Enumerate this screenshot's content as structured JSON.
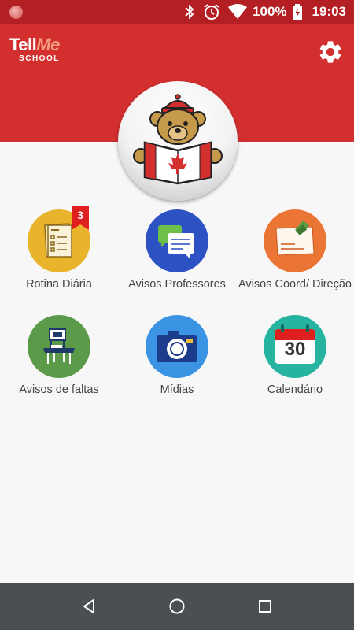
{
  "status_bar": {
    "battery": "100%",
    "time": "19:03",
    "icons": [
      "app-notification-icon",
      "bluetooth-icon",
      "alarm-icon",
      "wifi-icon",
      "battery-charging-icon"
    ]
  },
  "app_bar": {
    "logo_main_a": "Tell",
    "logo_main_b": "Me",
    "logo_sub": "SCHOOL",
    "settings_icon": "gear-icon",
    "colors": {
      "primary": "#d32f2f",
      "status": "#b31f22"
    }
  },
  "menu": {
    "items": [
      {
        "label": "Rotina Diária",
        "icon": "daily-routine-icon",
        "color": "#e9b32b",
        "badge": "3"
      },
      {
        "label": "Avisos Professores",
        "icon": "teacher-messages-icon",
        "color": "#2c52c4"
      },
      {
        "label": "Avisos Coord/ Direção",
        "icon": "coordination-notes-icon",
        "color": "#ea7535"
      },
      {
        "label": "Avisos de faltas",
        "icon": "absence-desk-icon",
        "color": "#5b9a49"
      },
      {
        "label": "Mídias",
        "icon": "camera-icon",
        "color": "#3a93e3"
      },
      {
        "label": "Calendário",
        "icon": "calendar-icon",
        "color": "#26b4a1",
        "calendar_day": "30"
      }
    ]
  },
  "nav_bar": {
    "icons": [
      "back-icon",
      "home-icon",
      "recents-icon"
    ]
  }
}
